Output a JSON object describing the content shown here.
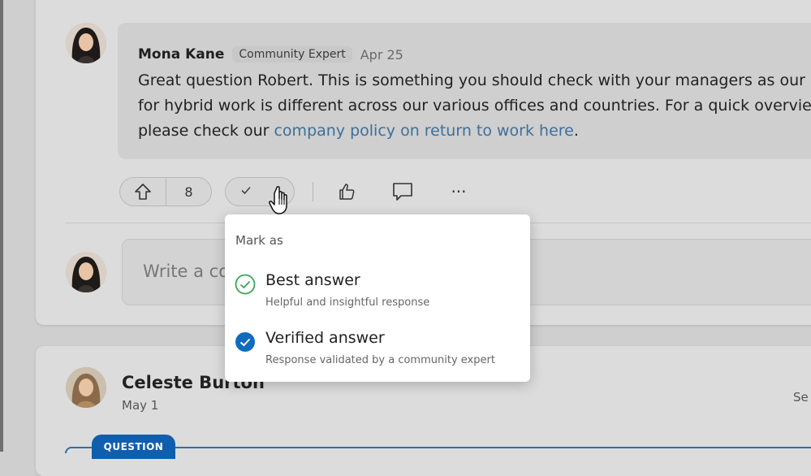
{
  "post": {
    "author": "Mona Kane",
    "badge": "Community Expert",
    "date": "Apr 25",
    "message_line1": "Great question Robert. This is something you should check with your managers as our",
    "message_line2": "for hybrid work is different across our various offices and countries. For a quick overvie",
    "message_line3_prefix": "please check our ",
    "message_link": "company policy on return to work here",
    "message_line3_suffix": "."
  },
  "actions": {
    "upvote_count": "8",
    "mark_icon": "check-icon",
    "like_icon": "thumbs-up-icon",
    "comment_icon": "comment-icon",
    "more_label": "···"
  },
  "reply": {
    "placeholder": "Write a co"
  },
  "mark_menu": {
    "title": "Mark as",
    "options": [
      {
        "label": "Best answer",
        "description": "Helpful and insightful response",
        "icon": "check-circle-outline-icon",
        "color": "#3aa657"
      },
      {
        "label": "Verified answer",
        "description": "Response validated by a community expert",
        "icon": "check-circle-filled-icon",
        "color": "#0f6cbd"
      }
    ]
  },
  "next_post": {
    "author": "Celeste Burton",
    "date": "May 1",
    "side_text": "Se",
    "tag": "QUESTION"
  },
  "colors": {
    "accent": "#0f6cbd",
    "link": "#3d6f9c",
    "success": "#3aa657"
  }
}
